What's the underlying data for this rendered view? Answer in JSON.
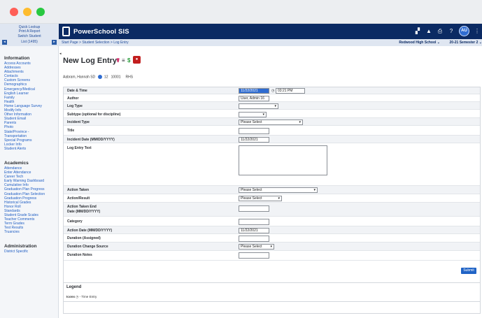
{
  "quick": {
    "lookup": "Quick Lookup",
    "print": "Print A Report",
    "switch": "Switch Student",
    "list": "List (1495)"
  },
  "header": {
    "brand": "PowerSchool SIS",
    "avatar": "AU",
    "breadcrumb": "Start Page > Student Selection > Log Entry",
    "school": "Redwood High School",
    "term": "20-21 Semester 2"
  },
  "sidebar": {
    "information_title": "Information",
    "information": [
      "Access Accounts",
      "Addresses",
      "Attachments",
      "Contacts",
      "Custom Screens",
      "Demographics",
      "Emergency/Medical",
      "English Learner",
      "Family",
      "Health",
      "Home Language Survey",
      "Modify Info",
      "Other Information",
      "Student Email",
      "Parents",
      "Photo",
      "State/Province -",
      "Transportation",
      "Special Programs",
      "Locker Info",
      "Student Alerts"
    ],
    "academics_title": "Academics",
    "academics": [
      "Attendance",
      "Enter Attendance",
      "Career Tech",
      "Early Warning Dashboard",
      "Cumulative Info",
      "Graduation Plan Progress",
      "Graduation Plan Selection",
      "Graduation Progress",
      "Historical Grades",
      "Honor Roll",
      "Standards",
      "Student Grade Scales",
      "Teacher Comments",
      "Term Grades",
      "Test Results",
      "Truancies"
    ],
    "administration_title": "Administration",
    "administration": [
      "District Specific"
    ]
  },
  "page": {
    "title": "New Log Entry",
    "student": "Aabram, Hannah SD",
    "grade": "12",
    "id": "10001",
    "school_code": "RHS"
  },
  "form": {
    "date_time_label": "Date & Time",
    "date_value": "11/22/2021",
    "time_value": "03:21 PM",
    "author_label": "Author",
    "author_value": "User, Admin 16",
    "log_type_label": "Log Type",
    "subtype_label": "Subtype (optional for discipline)",
    "incident_type_label": "Incident Type",
    "incident_type_value": "Please Select",
    "title_label": "Title",
    "incident_date_label": "Incident Date (MM/DD/YYYY)",
    "incident_date_value": "11/22/2021",
    "log_entry_text_label": "Log Entry Text",
    "action_taken_label": "Action Taken",
    "action_taken_value": "Please Select",
    "action_result_label": "Action/Result",
    "action_result_value": "Please Select",
    "action_end_label_1": "Action Taken End",
    "action_end_label_2": "Date (MM/DD/YYYY)",
    "category_label": "Category",
    "action_date_label": "Action Date (MM/DD/YYYY)",
    "action_date_value": "11/22/2021",
    "duration_assigned_label": "Duration (Assigned)",
    "duration_change_label": "Duration Change Source",
    "duration_change_value": "Please Select",
    "duration_notes_label": "Duration Notes",
    "submit_label": "Submit"
  },
  "legend": {
    "title": "Legend",
    "icons_label": "Icons",
    "time_entry": "- Time Entry"
  },
  "colors": {
    "topbar": "#0b2a63",
    "link": "#2360c4",
    "accent": "#1f63c6"
  }
}
